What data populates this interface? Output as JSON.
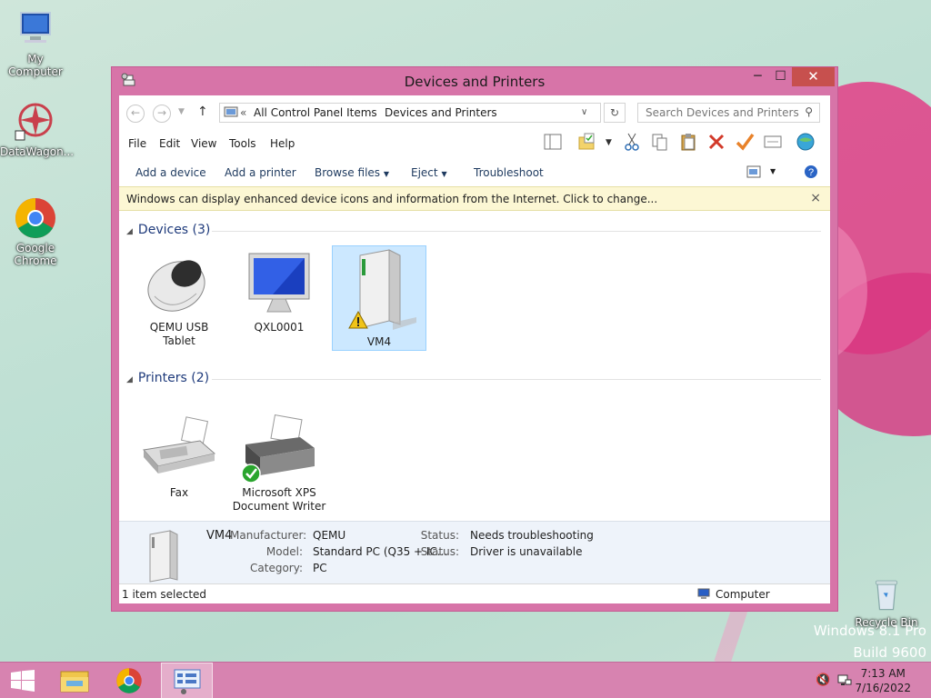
{
  "desktop": {
    "icons": [
      {
        "label": "My Computer"
      },
      {
        "label": "DataWagon..."
      },
      {
        "label": "Google Chrome"
      }
    ],
    "recycle_bin": "Recycle Bin",
    "watermark_line1": "Windows 8.1 Pro",
    "watermark_line2": "Build 9600"
  },
  "window": {
    "title": "Devices and Printers",
    "controls": {
      "minimize": "─",
      "maximize": "☐",
      "close": "✕"
    }
  },
  "address": {
    "overflow": "«",
    "crumbs": [
      "All Control Panel Items",
      "Devices and Printers"
    ],
    "search_placeholder": "Search Devices and Printers"
  },
  "menu": [
    "File",
    "Edit",
    "View",
    "Tools",
    "Help"
  ],
  "commands": [
    "Add a device",
    "Add a printer",
    "Browse files",
    "Eject",
    "Troubleshoot"
  ],
  "infobar": {
    "text": "Windows can display enhanced device icons and information from the Internet. Click to change...",
    "close": "×"
  },
  "groups": {
    "devices": {
      "label": "Devices (3)"
    },
    "printers": {
      "label": "Printers (2)"
    }
  },
  "devices": [
    {
      "name": "QEMU USB Tablet",
      "icon": "mouse-icon"
    },
    {
      "name": "QXL0001",
      "icon": "monitor-icon"
    },
    {
      "name": "VM4",
      "icon": "computer-tower-icon",
      "warning": true,
      "selected": true
    }
  ],
  "printers": [
    {
      "name": "Fax",
      "icon": "fax-icon"
    },
    {
      "name": "Microsoft XPS Document Writer",
      "icon": "printer-icon",
      "default": true
    }
  ],
  "details": {
    "name": "VM4",
    "manufacturer_label": "Manufacturer:",
    "manufacturer": "QEMU",
    "model_label": "Model:",
    "model": "Standard PC (Q35 + IC...",
    "category_label": "Category:",
    "category": "PC",
    "status_label": "Status:",
    "status1": "Needs troubleshooting",
    "status_label2": "Status:",
    "status2": "Driver is unavailable"
  },
  "statusbar": {
    "left": "1 item selected",
    "right": "Computer"
  },
  "taskbar": {
    "time": "7:13 AM",
    "date": "7/16/2022"
  },
  "colors": {
    "window_frame": "#d774a8",
    "taskbar": "#d783b0",
    "close_button": "#c7504e",
    "selection": "#cce8ff"
  }
}
